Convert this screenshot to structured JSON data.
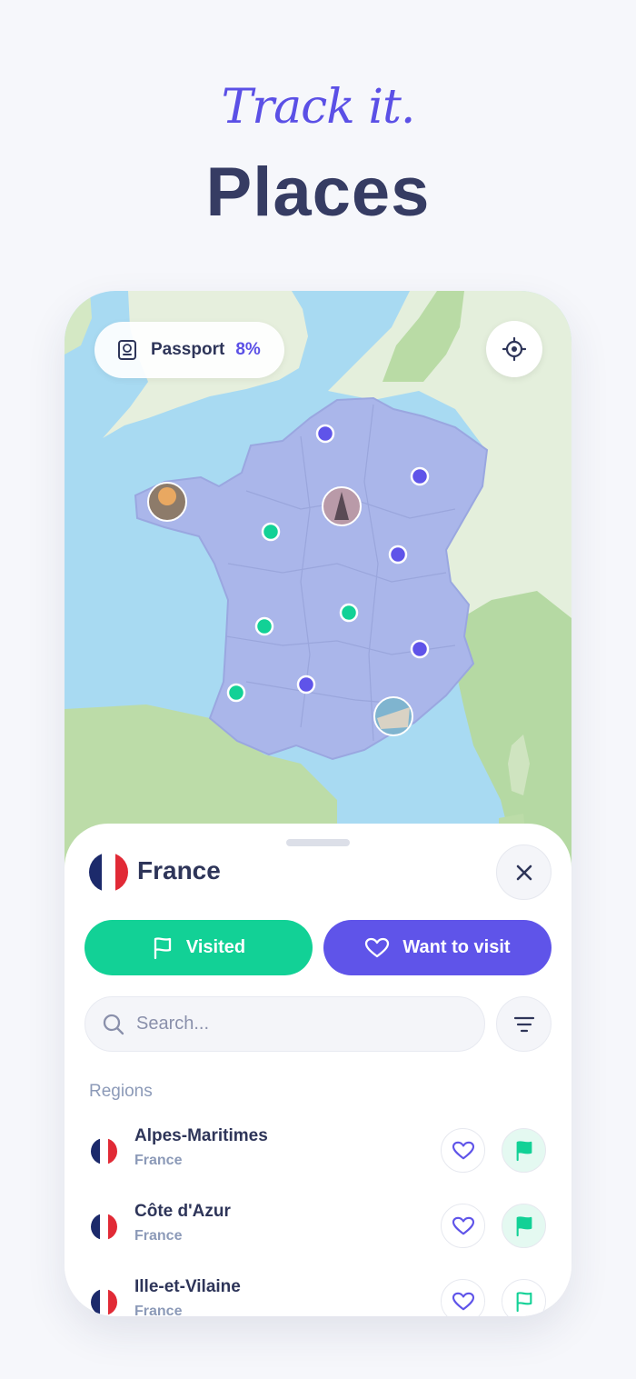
{
  "hero": {
    "tagline": "Track it.",
    "headline": "Places"
  },
  "colors": {
    "accent": "#5b50e6",
    "visited": "#12d196",
    "want": "#5f54e9",
    "title": "#363c63"
  },
  "map": {
    "passport_label": "Passport",
    "passport_percent": "8%",
    "passport_icon": "passport-icon",
    "locate_icon": "crosshair-icon"
  },
  "sheet": {
    "country": "France",
    "close_icon": "close-icon",
    "visited_label": "Visited",
    "want_label": "Want to visit",
    "search_placeholder": "Search...",
    "filter_icon": "filter-icon",
    "section_title": "Regions",
    "regions": [
      {
        "name": "Alpes-Maritimes",
        "country": "France",
        "visited": true
      },
      {
        "name": "Côte d'Azur",
        "country": "France",
        "visited": true
      },
      {
        "name": "Ille-et-Vilaine",
        "country": "France",
        "visited": false
      }
    ]
  }
}
